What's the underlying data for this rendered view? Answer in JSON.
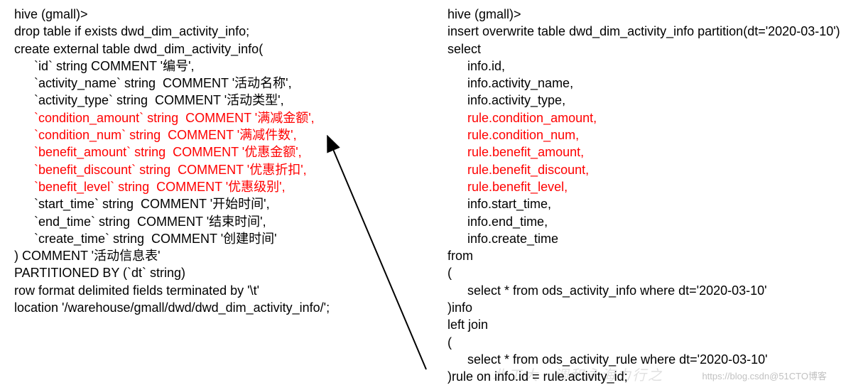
{
  "left": {
    "line1": "hive (gmall)>",
    "line2": "drop table if exists dwd_dim_activity_info;",
    "line3": "create external table dwd_dim_activity_info(",
    "line4": "`id` string COMMENT '编号',",
    "line5": "`activity_name` string  COMMENT '活动名称',",
    "line6": "`activity_type` string  COMMENT '活动类型',",
    "line7": "`condition_amount` string  COMMENT '满减金额',",
    "line8": "`condition_num` string  COMMENT '满减件数',",
    "line9": "`benefit_amount` string  COMMENT '优惠金额',",
    "line10": "`benefit_discount` string  COMMENT '优惠折扣',",
    "line11": "`benefit_level` string  COMMENT '优惠级别',",
    "line12": "`start_time` string  COMMENT '开始时间',",
    "line13": "`end_time` string  COMMENT '结束时间',",
    "line14": "`create_time` string  COMMENT '创建时间'",
    "line15": ") COMMENT '活动信息表'",
    "line16": "PARTITIONED BY (`dt` string)",
    "line17": "row format delimited fields terminated by '\\t'",
    "line18": "location '/warehouse/gmall/dwd/dwd_dim_activity_info/';"
  },
  "right": {
    "line1": "hive (gmall)>",
    "line2": "insert overwrite table dwd_dim_activity_info partition(dt='2020-03-10')",
    "line3": "select",
    "line4": "info.id,",
    "line5": "info.activity_name,",
    "line6": "info.activity_type,",
    "line7": "rule.condition_amount,",
    "line8": "rule.condition_num,",
    "line9": "rule.benefit_amount,",
    "line10": "rule.benefit_discount,",
    "line11": "rule.benefit_level,",
    "line12": "info.start_time,",
    "line13": "info.end_time,",
    "line14": "info.create_time",
    "line15": "from",
    "line16": "(",
    "line17": "select * from ods_activity_info where dt='2020-03-10'",
    "line18": ")info",
    "line19": "left join",
    "line20": "(",
    "line21": "select * from ods_activity_rule where dt='2020-03-10'",
    "line22": ")rule on info.id = rule.activity_id;"
  },
  "watermark1": "北工大 · 调和永海力行之",
  "watermark2": "https://blog.csdn@51CTO博客"
}
